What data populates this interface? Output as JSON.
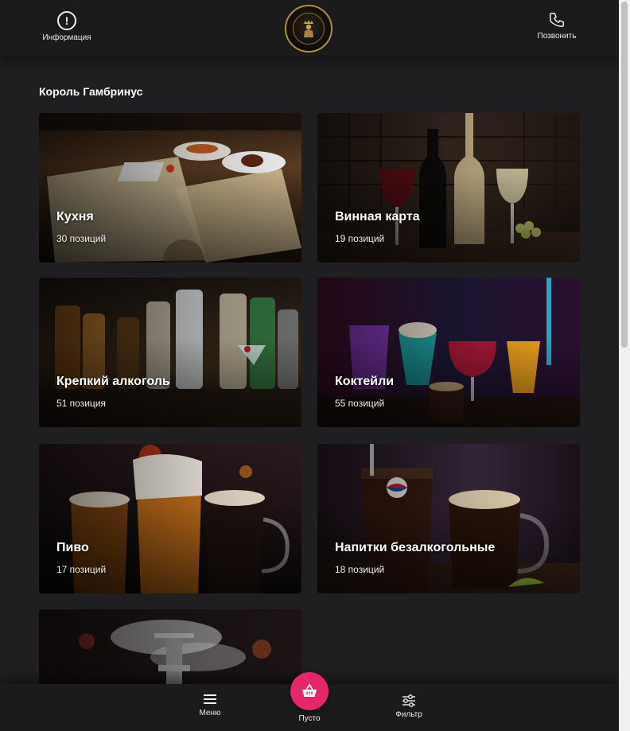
{
  "header": {
    "info_label": "Информация",
    "call_label": "Позвонить",
    "logo_top_text": "КОРОЛЬ ГАМБРИНУС",
    "logo_bottom_text": "KARAOKE CLUB"
  },
  "main": {
    "section_title": "Король Гамбринус",
    "categories": [
      {
        "title": "Кухня",
        "count": "30 позиций"
      },
      {
        "title": "Винная карта",
        "count": "19 позиций"
      },
      {
        "title": "Крепкий алкоголь",
        "count": "51 позиция"
      },
      {
        "title": "Коктейли",
        "count": "55 позиций"
      },
      {
        "title": "Пиво",
        "count": "17 позиций"
      },
      {
        "title": "Напитки безалкогольные",
        "count": "18 позиций"
      },
      {
        "title": "",
        "count": ""
      }
    ]
  },
  "bottom_nav": {
    "menu_label": "Меню",
    "cart_label": "Пусто",
    "filter_label": "Фильтр"
  },
  "colors": {
    "background": "#1f1f21",
    "accent": "#e5266b",
    "logo_gold": "#b08d47"
  }
}
